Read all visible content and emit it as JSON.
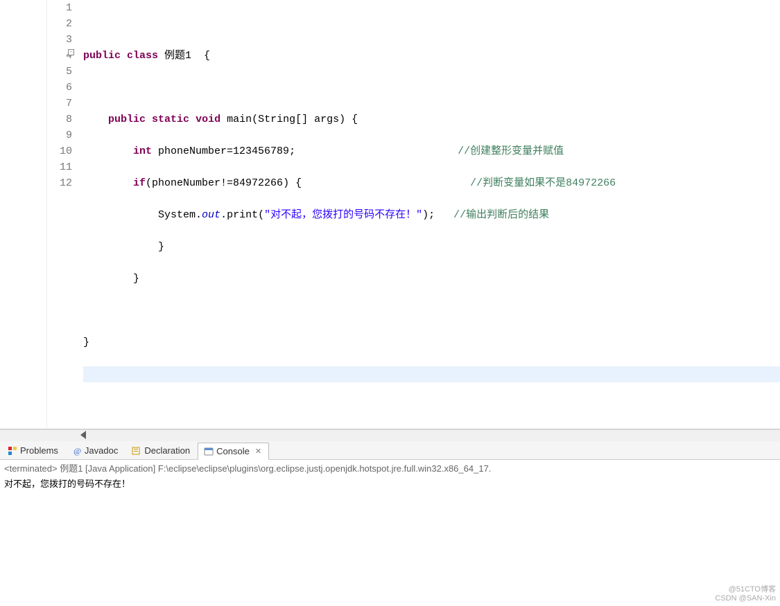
{
  "editor": {
    "lineNumbers": [
      "1",
      "2",
      "3",
      "4",
      "5",
      "6",
      "7",
      "8",
      "9",
      "10",
      "11",
      "12"
    ],
    "code": {
      "l2_kw1": "public",
      "l2_kw2": "class",
      "l2_name": " 例题1  {",
      "l4_kw1": "public",
      "l4_kw2": "static",
      "l4_kw3": "void",
      "l4_rest": " main(String[] args) {",
      "l5_kw": "int",
      "l5_rest": " phoneNumber=123456789;",
      "l5_cmt": "//创建整形变量并赋值",
      "l6_kw": "if",
      "l6_rest": "(phoneNumber!=84972266) {",
      "l6_cmt": "//判断变量如果不是84972266",
      "l7_pre": "System.",
      "l7_out": "out",
      "l7_mid": ".print(",
      "l7_str": "\"对不起，您拨打的号码不存在！\"",
      "l7_post": ");",
      "l7_cmt": "//输出判断后的结果",
      "l8": "            }",
      "l9": "        }",
      "l11": "}"
    }
  },
  "tabs": {
    "problems": "Problems",
    "javadoc": "Javadoc",
    "declaration": "Declaration",
    "console": "Console"
  },
  "console": {
    "header": "<terminated> 例题1 [Java Application] F:\\eclipse\\eclipse\\plugins\\org.eclipse.justj.openjdk.hotspot.jre.full.win32.x86_64_17.",
    "output": "对不起，您拨打的号码不存在！"
  },
  "watermark": {
    "line1": "@51CTO博客",
    "line2": "CSDN @SAN-Xin"
  }
}
